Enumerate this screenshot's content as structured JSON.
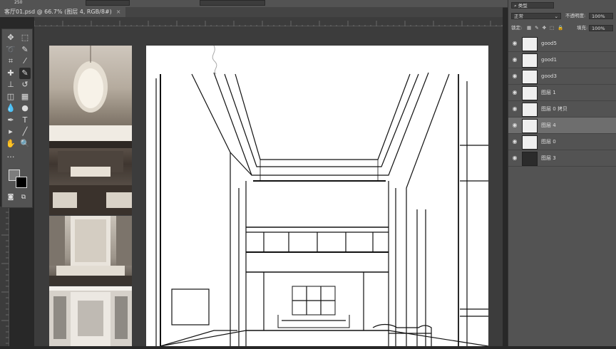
{
  "options_bar": {
    "brush_size": "250"
  },
  "document_tab": {
    "title": "客厅01.psd @ 66.7% (图层 4, RGB/8#)",
    "close": "×"
  },
  "tools": [
    {
      "name": "move-tool-icon",
      "glyph": "✥"
    },
    {
      "name": "marquee-tool-icon",
      "glyph": "⬚"
    },
    {
      "name": "lasso-tool-icon",
      "glyph": "➰"
    },
    {
      "name": "quick-select-tool-icon",
      "glyph": "✎"
    },
    {
      "name": "crop-tool-icon",
      "glyph": "⌗"
    },
    {
      "name": "eyedropper-tool-icon",
      "glyph": "⁄"
    },
    {
      "name": "healing-tool-icon",
      "glyph": "✚"
    },
    {
      "name": "brush-tool-icon",
      "glyph": "✎"
    },
    {
      "name": "stamp-tool-icon",
      "glyph": "⊥"
    },
    {
      "name": "history-brush-icon",
      "glyph": "↺"
    },
    {
      "name": "eraser-tool-icon",
      "glyph": "◫"
    },
    {
      "name": "gradient-tool-icon",
      "glyph": "▦"
    },
    {
      "name": "blur-tool-icon",
      "glyph": "💧"
    },
    {
      "name": "dodge-tool-icon",
      "glyph": "●"
    },
    {
      "name": "pen-tool-icon",
      "glyph": "✒"
    },
    {
      "name": "type-tool-icon",
      "glyph": "T"
    },
    {
      "name": "path-select-tool-icon",
      "glyph": "▸"
    },
    {
      "name": "line-tool-icon",
      "glyph": "╱"
    },
    {
      "name": "hand-tool-icon",
      "glyph": "✋"
    },
    {
      "name": "zoom-tool-icon",
      "glyph": "🔍"
    },
    {
      "name": "more-tools-icon",
      "glyph": "…"
    }
  ],
  "layers_panel": {
    "search_label": "类型",
    "blend_mode": "正常",
    "opacity_label": "不透明度:",
    "opacity_value": "100%",
    "lock_label": "锁定:",
    "fill_label": "填充:",
    "fill_value": "100%",
    "layers": [
      {
        "name": "good5",
        "thumb": "light",
        "selected": false
      },
      {
        "name": "good1",
        "thumb": "light",
        "selected": false
      },
      {
        "name": "good3",
        "thumb": "light",
        "selected": false
      },
      {
        "name": "图层 1",
        "thumb": "light",
        "selected": false
      },
      {
        "name": "图层 0 拷贝",
        "thumb": "light",
        "selected": false
      },
      {
        "name": "图层 4",
        "thumb": "light",
        "selected": true
      },
      {
        "name": "图层 0",
        "thumb": "light",
        "selected": false
      },
      {
        "name": "图层 3",
        "thumb": "dark",
        "selected": false
      }
    ]
  },
  "colors": {
    "foreground": "#7d7d7d",
    "background": "#000000",
    "panel": "#535353",
    "canvas_bg": "#3c3c3c"
  }
}
